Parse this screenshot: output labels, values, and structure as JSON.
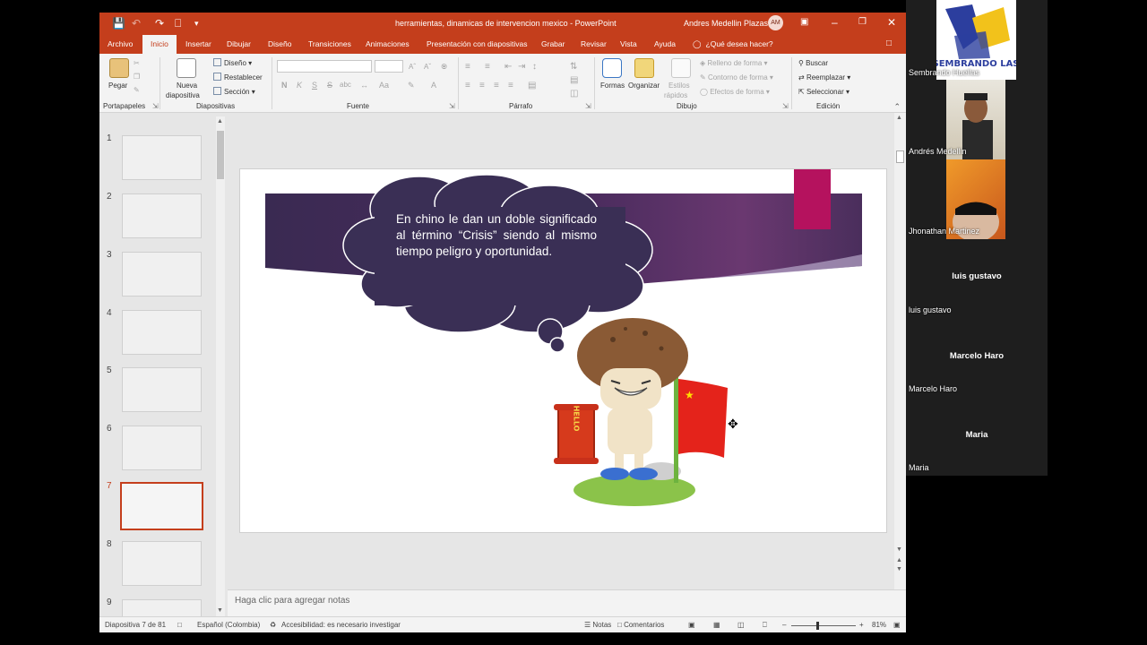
{
  "window": {
    "title": "herramientas, dinamicas de intervencion mexico  -  PowerPoint",
    "user_name": "Andres Medellin Plazas",
    "user_initials": "AM",
    "accent": "#c43e1c"
  },
  "quick_access": {
    "save_icon": "save-icon",
    "undo_icon": "undo-icon",
    "redo_icon": "redo-icon",
    "present_icon": "present-icon"
  },
  "tabs": [
    {
      "label": "Archivo"
    },
    {
      "label": "Inicio"
    },
    {
      "label": "Insertar"
    },
    {
      "label": "Dibujar"
    },
    {
      "label": "Diseño"
    },
    {
      "label": "Transiciones"
    },
    {
      "label": "Animaciones"
    },
    {
      "label": "Presentación con diapositivas"
    },
    {
      "label": "Grabar"
    },
    {
      "label": "Revisar"
    },
    {
      "label": "Vista"
    },
    {
      "label": "Ayuda"
    }
  ],
  "tell_me": "¿Qué desea hacer?",
  "ribbon": {
    "portapapeles": {
      "label": "Portapapeles",
      "paste": "Pegar"
    },
    "diapositivas": {
      "label": "Diapositivas",
      "new_slide_1": "Nueva",
      "new_slide_2": "diapositiva",
      "layout": "Diseño",
      "reset": "Restablecer",
      "section": "Sección"
    },
    "fuente": {
      "label": "Fuente",
      "bold": "N",
      "italic": "K",
      "underline": "S",
      "strike": "S",
      "spacing": "abc",
      "case": "Aa",
      "color": "A"
    },
    "parrafo": {
      "label": "Párrafo"
    },
    "dibujo": {
      "label": "Dibujo",
      "shapes": "Formas",
      "arrange": "Organizar",
      "quick_styles_1": "Estilos",
      "quick_styles_2": "rápidos",
      "fill": "Relleno de forma",
      "outline": "Contorno de forma",
      "effects": "Efectos de forma"
    },
    "edicion": {
      "label": "Edición",
      "find": "Buscar",
      "replace": "Reemplazar",
      "select": "Seleccionar"
    }
  },
  "thumbnails": [
    {
      "num": "1"
    },
    {
      "num": "2"
    },
    {
      "num": "3"
    },
    {
      "num": "4"
    },
    {
      "num": "5"
    },
    {
      "num": "6"
    },
    {
      "num": "7",
      "selected": true
    },
    {
      "num": "8"
    },
    {
      "num": "9"
    }
  ],
  "slide": {
    "bubble_text": "En chino le dan un doble significado al término “Crisis” siendo al mismo tiempo peligro y oportunidad.",
    "scroll_text": "HELLO",
    "banner_color": "#3a2a55",
    "magenta": "#b5125e"
  },
  "notes_placeholder": "Haga clic para agregar notas",
  "status": {
    "slide_info": "Diapositiva 7 de 81",
    "language": "Español (Colombia)",
    "accessibility": "Accesibilidad: es necesario investigar",
    "notes": "Notas",
    "comments": "Comentarios",
    "zoom": "81%"
  },
  "participants": [
    {
      "name": "Sembrando Huellas",
      "logo_text": "SEMBRANDO LAS"
    },
    {
      "name": "Andrés Medellin"
    },
    {
      "name": "Jhonathan Martinez"
    },
    {
      "name": "luis gustavo",
      "center": "luis gustavo"
    },
    {
      "name": "Marcelo Haro",
      "center": "Marcelo Haro"
    },
    {
      "name": "Maria",
      "center": "Maria"
    }
  ]
}
